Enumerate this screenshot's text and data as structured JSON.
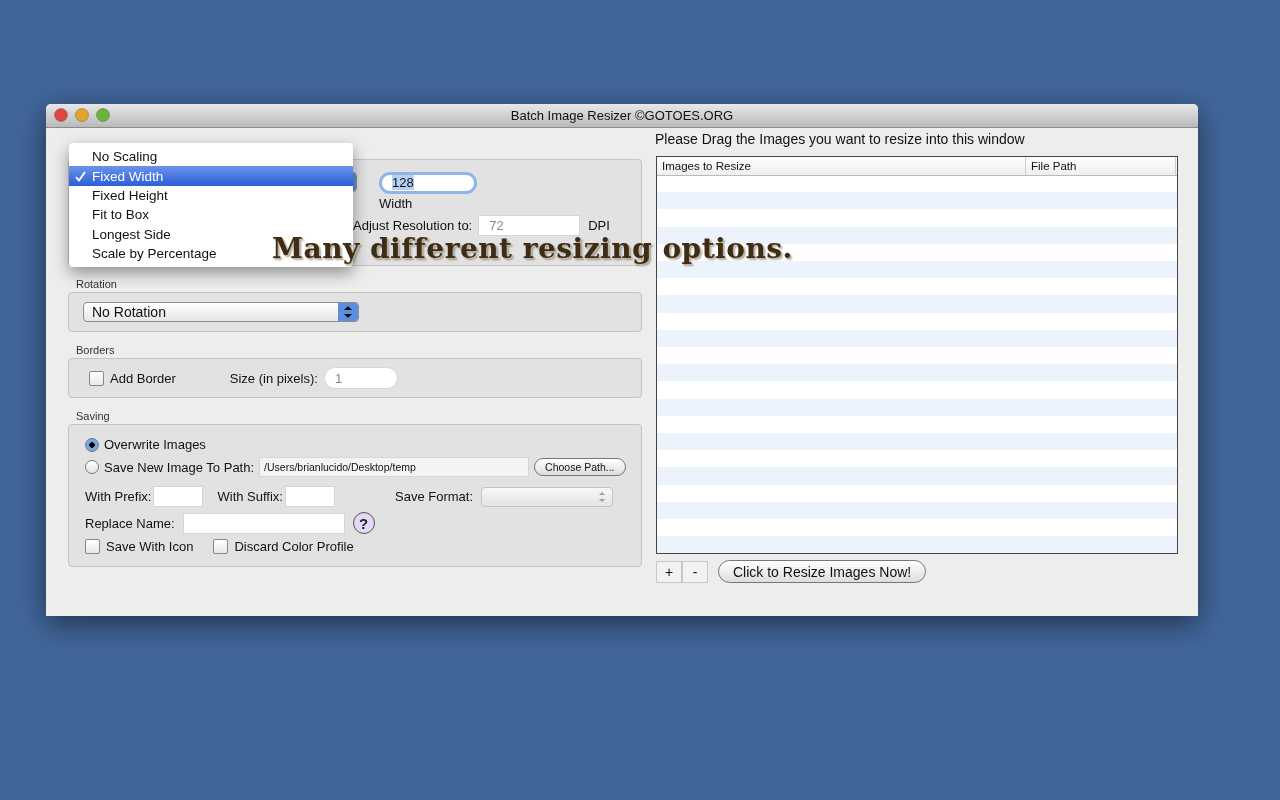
{
  "window": {
    "title": "Batch Image Resizer ©GOTOES.ORG"
  },
  "scaling": {
    "menu": [
      {
        "label": "No Scaling",
        "selected": false
      },
      {
        "label": "Fixed Width",
        "selected": true
      },
      {
        "label": "Fixed Height",
        "selected": false
      },
      {
        "label": "Fit to Box",
        "selected": false
      },
      {
        "label": "Longest Side",
        "selected": false
      },
      {
        "label": "Scale by Percentage",
        "selected": false
      }
    ],
    "width_value": "128",
    "width_label": "Width",
    "resolution_label": "Adjust Resolution to:",
    "resolution_value": "72",
    "resolution_unit": "DPI"
  },
  "rotation": {
    "title": "Rotation",
    "value": "No Rotation"
  },
  "borders": {
    "title": "Borders",
    "add_border": {
      "label": "Add Border",
      "checked": false
    },
    "size_label": "Size (in pixels):",
    "size_value": "1"
  },
  "saving": {
    "title": "Saving",
    "options": [
      {
        "label": "Overwrite Images",
        "selected": true
      },
      {
        "label": "Save New Image To Path:",
        "selected": false
      }
    ],
    "path_value": "/Users/brianlucido/Desktop/temp",
    "choose_path": "Choose Path...",
    "prefix_label": "With Prefix:",
    "suffix_label": "With Suffix:",
    "format_label": "Save Format:",
    "replace_label": "Replace Name:",
    "help": "?",
    "checks": [
      {
        "label": "Save With Icon",
        "checked": false
      },
      {
        "label": "Discard Color Profile",
        "checked": false
      }
    ]
  },
  "drop_hint": "Please Drag the Images you want to resize into this window",
  "table": {
    "columns": [
      "Images to Resize",
      "File Path"
    ]
  },
  "add": "+",
  "remove": "-",
  "resize_button": "Click to Resize Images Now!",
  "caption": "Many different resizing options."
}
